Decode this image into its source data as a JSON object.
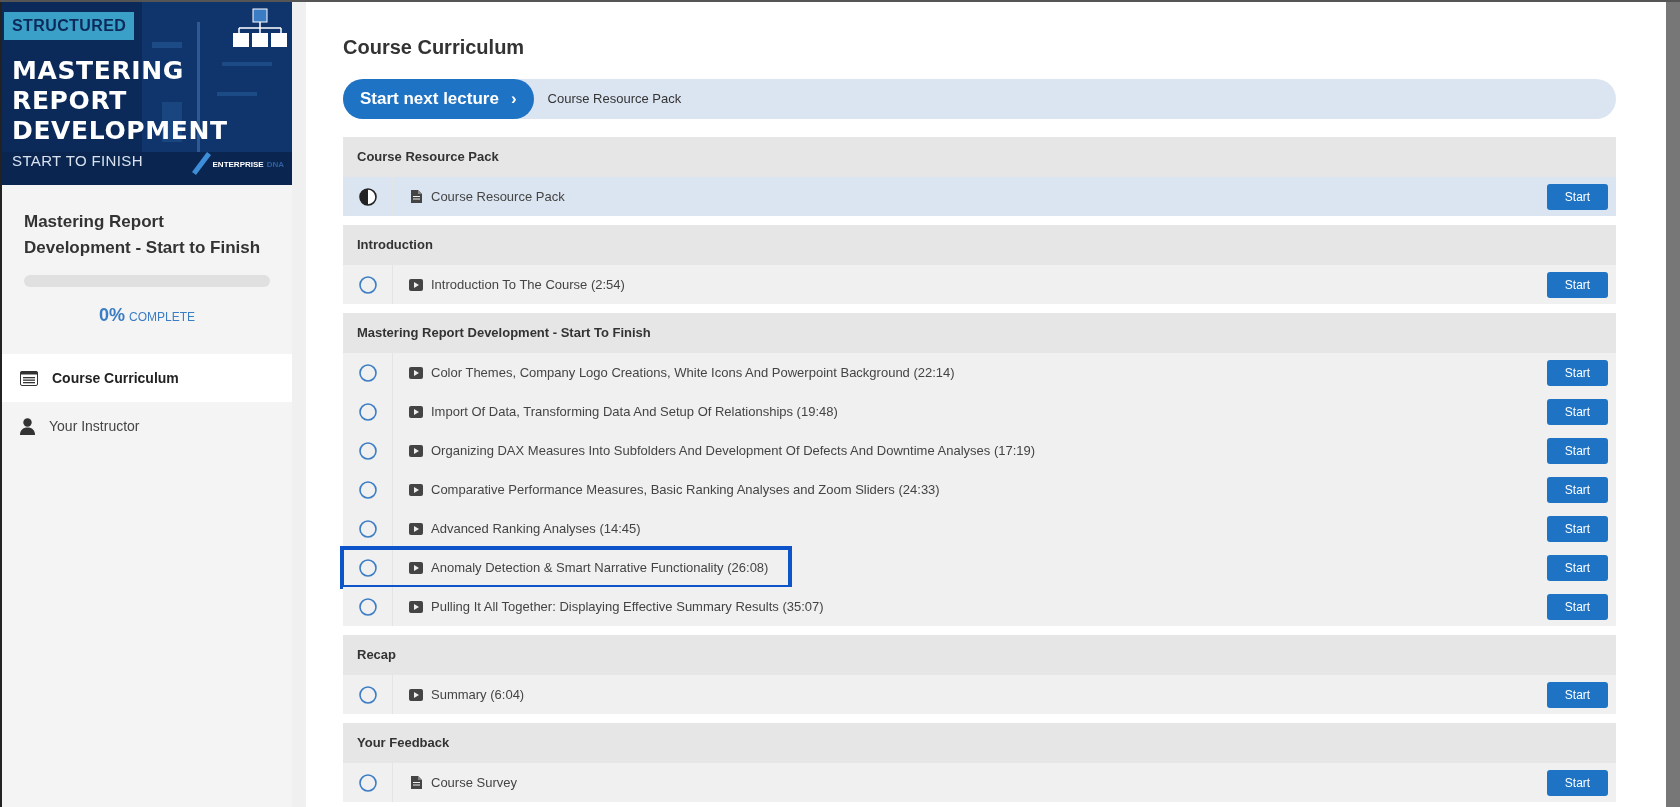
{
  "banner": {
    "tag": "STRUCTURED",
    "title_lines": [
      "MASTERING",
      "REPORT",
      "DEVELOPMENT"
    ],
    "subtitle": "START TO FINISH",
    "brand": "ENTERPRISE",
    "brand_suffix": "DNA"
  },
  "course": {
    "title": "Mastering Report Development - Start to Finish",
    "progress": {
      "level": 0,
      "percent": "0%",
      "label": "COMPLETE"
    }
  },
  "sidebar": {
    "items": [
      {
        "label": "Course Curriculum",
        "kind": "list",
        "selected": true
      },
      {
        "label": "Your Instructor",
        "kind": "person",
        "selected": false
      }
    ]
  },
  "main": {
    "title": "Course Curriculum",
    "next_button": "Start next lecture",
    "next_arrow": "›",
    "next_lecture": "Course Resource Pack"
  },
  "sections": [
    {
      "title": "Course Resource Pack",
      "lectures": [
        {
          "title": "Course Resource Pack",
          "kind": "file",
          "started": true,
          "current": true,
          "highlighted": false,
          "button": "Start"
        }
      ]
    },
    {
      "title": "Introduction",
      "lectures": [
        {
          "title": "Introduction To The Course (2:54)",
          "kind": "video",
          "started": false,
          "current": false,
          "highlighted": false,
          "button": "Start"
        }
      ]
    },
    {
      "title": "Mastering Report Development - Start To Finish",
      "lectures": [
        {
          "title": "Color Themes, Company Logo Creations, White Icons And Powerpoint Background (22:14)",
          "kind": "video",
          "started": false,
          "current": false,
          "highlighted": false,
          "button": "Start"
        },
        {
          "title": "Import Of Data, Transforming Data And Setup Of Relationships (19:48)",
          "kind": "video",
          "started": false,
          "current": false,
          "highlighted": false,
          "button": "Start"
        },
        {
          "title": "Organizing DAX Measures Into Subfolders And Development Of Defects And Downtime Analyses (17:19)",
          "kind": "video",
          "started": false,
          "current": false,
          "highlighted": false,
          "button": "Start"
        },
        {
          "title": "Comparative Performance Measures, Basic Ranking Analyses and Zoom Sliders (24:33)",
          "kind": "video",
          "started": false,
          "current": false,
          "highlighted": false,
          "button": "Start"
        },
        {
          "title": "Advanced Ranking Analyses (14:45)",
          "kind": "video",
          "started": false,
          "current": false,
          "highlighted": false,
          "button": "Start"
        },
        {
          "title": "Anomaly Detection & Smart Narrative Functionality (26:08)",
          "kind": "video",
          "started": false,
          "current": false,
          "highlighted": true,
          "button": "Start"
        },
        {
          "title": "Pulling It All Together: Displaying Effective Summary Results (35:07)",
          "kind": "video",
          "started": false,
          "current": false,
          "highlighted": false,
          "button": "Start"
        }
      ]
    },
    {
      "title": "Recap",
      "lectures": [
        {
          "title": "Summary (6:04)",
          "kind": "video",
          "started": false,
          "current": false,
          "highlighted": false,
          "button": "Start"
        }
      ]
    },
    {
      "title": "Your Feedback",
      "lectures": [
        {
          "title": "Course Survey",
          "kind": "file",
          "started": false,
          "current": false,
          "highlighted": false,
          "button": "Start"
        }
      ]
    }
  ]
}
